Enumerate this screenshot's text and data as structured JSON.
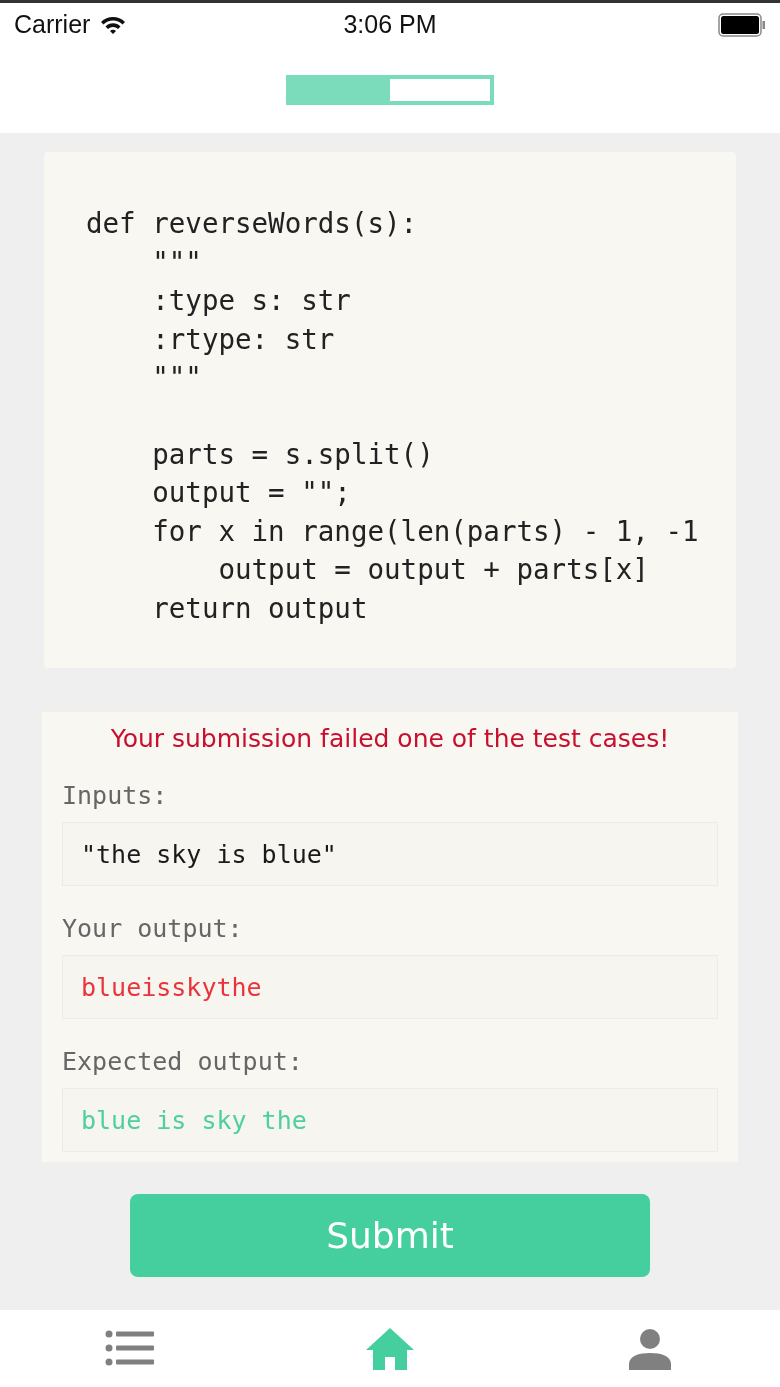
{
  "status_bar": {
    "carrier": "Carrier",
    "time": "3:06 PM"
  },
  "progress": {
    "level": 0.5
  },
  "code": {
    "blocks": [
      [
        "def reverseWords(s):",
        "    \"\"\"",
        "    :type s: str",
        "    :rtype: str",
        "    \"\"\""
      ],
      [
        "    parts = s.split()",
        "    output = \"\";",
        "    for x in range(len(parts) - 1, -1",
        "        output = output + parts[x]",
        "    return output"
      ]
    ]
  },
  "result": {
    "message": "Your submission failed one of the test cases!",
    "fields": [
      {
        "label": "Inputs:",
        "value": "\"the sky is blue\"",
        "color": "#1a1a1a"
      },
      {
        "label": "Your output:",
        "value": "blueisskythe",
        "color": "#e8343a"
      },
      {
        "label": "Expected output:",
        "value": "blue is sky the",
        "color": "#4ecfa0"
      }
    ]
  },
  "submit_button": "Submit",
  "tab_bar": [
    {
      "kind": "list",
      "selected": false
    },
    {
      "kind": "home",
      "selected": true
    },
    {
      "kind": "person",
      "selected": false
    }
  ]
}
